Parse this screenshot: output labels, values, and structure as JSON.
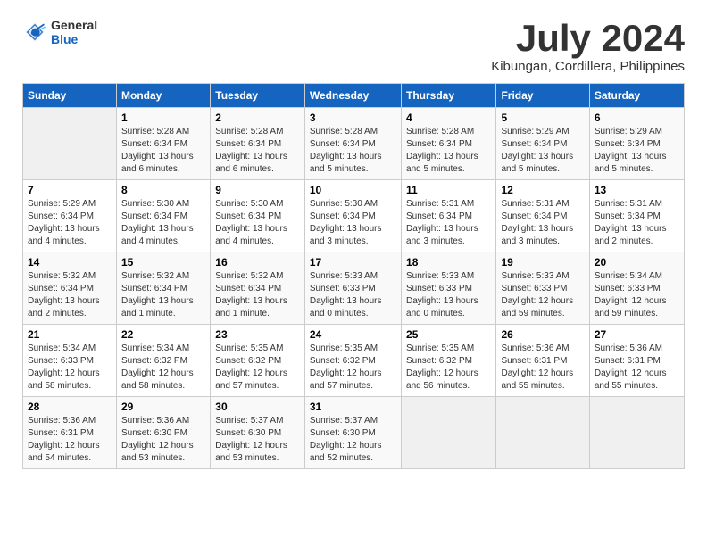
{
  "header": {
    "logo_general": "General",
    "logo_blue": "Blue",
    "month_title": "July 2024",
    "location": "Kibungan, Cordillera, Philippines"
  },
  "weekdays": [
    "Sunday",
    "Monday",
    "Tuesday",
    "Wednesday",
    "Thursday",
    "Friday",
    "Saturday"
  ],
  "weeks": [
    [
      {
        "day": "",
        "info": ""
      },
      {
        "day": "1",
        "info": "Sunrise: 5:28 AM\nSunset: 6:34 PM\nDaylight: 13 hours\nand 6 minutes."
      },
      {
        "day": "2",
        "info": "Sunrise: 5:28 AM\nSunset: 6:34 PM\nDaylight: 13 hours\nand 6 minutes."
      },
      {
        "day": "3",
        "info": "Sunrise: 5:28 AM\nSunset: 6:34 PM\nDaylight: 13 hours\nand 5 minutes."
      },
      {
        "day": "4",
        "info": "Sunrise: 5:28 AM\nSunset: 6:34 PM\nDaylight: 13 hours\nand 5 minutes."
      },
      {
        "day": "5",
        "info": "Sunrise: 5:29 AM\nSunset: 6:34 PM\nDaylight: 13 hours\nand 5 minutes."
      },
      {
        "day": "6",
        "info": "Sunrise: 5:29 AM\nSunset: 6:34 PM\nDaylight: 13 hours\nand 5 minutes."
      }
    ],
    [
      {
        "day": "7",
        "info": "Sunrise: 5:29 AM\nSunset: 6:34 PM\nDaylight: 13 hours\nand 4 minutes."
      },
      {
        "day": "8",
        "info": "Sunrise: 5:30 AM\nSunset: 6:34 PM\nDaylight: 13 hours\nand 4 minutes."
      },
      {
        "day": "9",
        "info": "Sunrise: 5:30 AM\nSunset: 6:34 PM\nDaylight: 13 hours\nand 4 minutes."
      },
      {
        "day": "10",
        "info": "Sunrise: 5:30 AM\nSunset: 6:34 PM\nDaylight: 13 hours\nand 3 minutes."
      },
      {
        "day": "11",
        "info": "Sunrise: 5:31 AM\nSunset: 6:34 PM\nDaylight: 13 hours\nand 3 minutes."
      },
      {
        "day": "12",
        "info": "Sunrise: 5:31 AM\nSunset: 6:34 PM\nDaylight: 13 hours\nand 3 minutes."
      },
      {
        "day": "13",
        "info": "Sunrise: 5:31 AM\nSunset: 6:34 PM\nDaylight: 13 hours\nand 2 minutes."
      }
    ],
    [
      {
        "day": "14",
        "info": "Sunrise: 5:32 AM\nSunset: 6:34 PM\nDaylight: 13 hours\nand 2 minutes."
      },
      {
        "day": "15",
        "info": "Sunrise: 5:32 AM\nSunset: 6:34 PM\nDaylight: 13 hours\nand 1 minute."
      },
      {
        "day": "16",
        "info": "Sunrise: 5:32 AM\nSunset: 6:34 PM\nDaylight: 13 hours\nand 1 minute."
      },
      {
        "day": "17",
        "info": "Sunrise: 5:33 AM\nSunset: 6:33 PM\nDaylight: 13 hours\nand 0 minutes."
      },
      {
        "day": "18",
        "info": "Sunrise: 5:33 AM\nSunset: 6:33 PM\nDaylight: 13 hours\nand 0 minutes."
      },
      {
        "day": "19",
        "info": "Sunrise: 5:33 AM\nSunset: 6:33 PM\nDaylight: 12 hours\nand 59 minutes."
      },
      {
        "day": "20",
        "info": "Sunrise: 5:34 AM\nSunset: 6:33 PM\nDaylight: 12 hours\nand 59 minutes."
      }
    ],
    [
      {
        "day": "21",
        "info": "Sunrise: 5:34 AM\nSunset: 6:33 PM\nDaylight: 12 hours\nand 58 minutes."
      },
      {
        "day": "22",
        "info": "Sunrise: 5:34 AM\nSunset: 6:32 PM\nDaylight: 12 hours\nand 58 minutes."
      },
      {
        "day": "23",
        "info": "Sunrise: 5:35 AM\nSunset: 6:32 PM\nDaylight: 12 hours\nand 57 minutes."
      },
      {
        "day": "24",
        "info": "Sunrise: 5:35 AM\nSunset: 6:32 PM\nDaylight: 12 hours\nand 57 minutes."
      },
      {
        "day": "25",
        "info": "Sunrise: 5:35 AM\nSunset: 6:32 PM\nDaylight: 12 hours\nand 56 minutes."
      },
      {
        "day": "26",
        "info": "Sunrise: 5:36 AM\nSunset: 6:31 PM\nDaylight: 12 hours\nand 55 minutes."
      },
      {
        "day": "27",
        "info": "Sunrise: 5:36 AM\nSunset: 6:31 PM\nDaylight: 12 hours\nand 55 minutes."
      }
    ],
    [
      {
        "day": "28",
        "info": "Sunrise: 5:36 AM\nSunset: 6:31 PM\nDaylight: 12 hours\nand 54 minutes."
      },
      {
        "day": "29",
        "info": "Sunrise: 5:36 AM\nSunset: 6:30 PM\nDaylight: 12 hours\nand 53 minutes."
      },
      {
        "day": "30",
        "info": "Sunrise: 5:37 AM\nSunset: 6:30 PM\nDaylight: 12 hours\nand 53 minutes."
      },
      {
        "day": "31",
        "info": "Sunrise: 5:37 AM\nSunset: 6:30 PM\nDaylight: 12 hours\nand 52 minutes."
      },
      {
        "day": "",
        "info": ""
      },
      {
        "day": "",
        "info": ""
      },
      {
        "day": "",
        "info": ""
      }
    ]
  ]
}
